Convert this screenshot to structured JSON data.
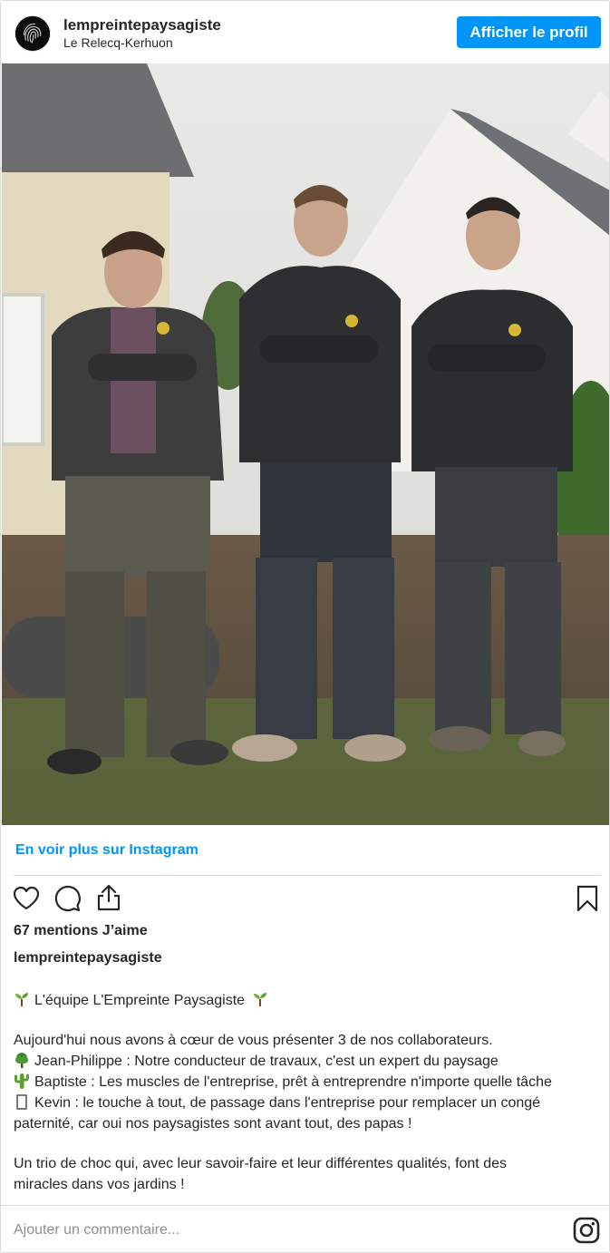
{
  "header": {
    "username": "lempreintepaysagiste",
    "location": "Le Relecq-Kerhuon",
    "profile_button": "Afficher le profil"
  },
  "post": {
    "more_link": "En voir plus sur Instagram",
    "likes": "67 mentions J’aime",
    "caption_user": "lempreintepaysagiste",
    "caption_lines": [
      {
        "emoji": "sprout-icon",
        "text": "L'équipe L'Empreinte Paysagiste",
        "emoji_after": "sprout-icon"
      },
      {
        "text": "Aujourd'hui nous avons à cœur de vous présenter 3 de nos collaborateurs."
      },
      {
        "emoji": "tree-icon",
        "text": "Jean-Philippe : Notre conducteur de travaux, c'est un expert du paysage"
      },
      {
        "emoji": "cactus-icon",
        "text": "Baptiste : Les muscles de l'entreprise, prêt à entreprendre n'importe quelle tâche"
      },
      {
        "emoji": "missing-glyph-icon",
        "text": "Kevin : le touche à tout, de passage dans l'entreprise pour remplacer un congé"
      },
      {
        "text": "paternité, car oui nos paysagistes sont avant tout, des papas !"
      },
      {
        "text": "Un trio de choc qui, avec leur savoir-faire et leur différentes qualités, font des"
      },
      {
        "text": "miracles dans vos jardins !"
      }
    ]
  },
  "comment": {
    "placeholder": "Ajouter un commentaire..."
  },
  "colors": {
    "accent": "#0095f6",
    "text": "#262626",
    "muted": "#8e8e8e",
    "border": "#dbdbdb"
  }
}
